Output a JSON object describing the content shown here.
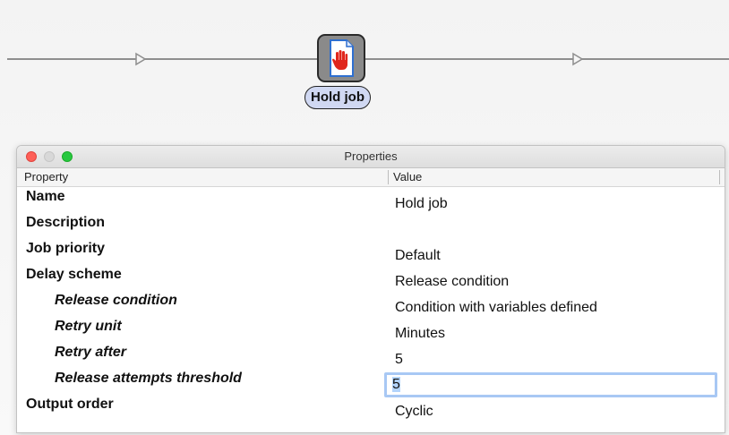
{
  "node": {
    "label": "Hold job",
    "icon": "hand-stop-icon"
  },
  "window": {
    "title": "Properties",
    "buttons": [
      "close",
      "minimize",
      "zoom"
    ]
  },
  "table": {
    "columns": [
      "Property",
      "Value"
    ],
    "rows": [
      {
        "name": "Name",
        "value": "Hold job",
        "indent": false
      },
      {
        "name": "Description",
        "value": "",
        "indent": false
      },
      {
        "name": "Job priority",
        "value": "Default",
        "indent": false
      },
      {
        "name": "Delay scheme",
        "value": "Release condition",
        "indent": false
      },
      {
        "name": "Release condition",
        "value": "Condition with variables defined",
        "indent": true
      },
      {
        "name": "Retry unit",
        "value": "Minutes",
        "indent": true
      },
      {
        "name": "Retry after",
        "value": "5",
        "indent": true
      },
      {
        "name": "Release attempts threshold",
        "value": "5",
        "indent": true,
        "editing": true
      },
      {
        "name": "Output order",
        "value": "Cyclic",
        "indent": false
      }
    ]
  },
  "colors": {
    "close": "#fe5f57",
    "minimize": "#d8d8d8",
    "zoom": "#28c840",
    "node_label_bg": "#d0d8f2",
    "edit_focus": "#a8c8f4",
    "hand": "#e0261c"
  }
}
